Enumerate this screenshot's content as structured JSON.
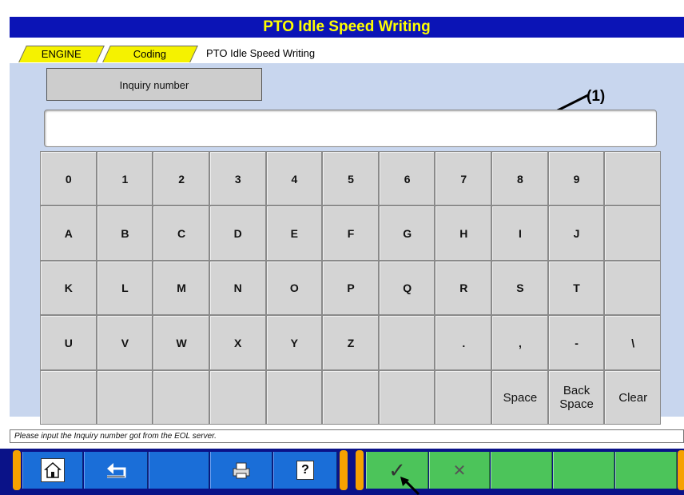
{
  "title": "PTO Idle Speed Writing",
  "breadcrumb": {
    "tab1": "ENGINE",
    "tab2": "Coding",
    "current": "PTO Idle Speed Writing"
  },
  "inquiry_label": "Inquiry number",
  "annotation": {
    "marker": "(1)"
  },
  "keypad": {
    "row1": [
      "0",
      "1",
      "2",
      "3",
      "4",
      "5",
      "6",
      "7",
      "8",
      "9",
      ""
    ],
    "row2": [
      "A",
      "B",
      "C",
      "D",
      "E",
      "F",
      "G",
      "H",
      "I",
      "J",
      ""
    ],
    "row3": [
      "K",
      "L",
      "M",
      "N",
      "O",
      "P",
      "Q",
      "R",
      "S",
      "T",
      ""
    ],
    "row4": [
      "U",
      "V",
      "W",
      "X",
      "Y",
      "Z",
      "",
      ".",
      ",",
      "-",
      "\\"
    ],
    "row5": [
      "",
      "",
      "",
      "",
      "",
      "",
      "",
      "",
      "Space",
      "Back\nSpace",
      "Clear"
    ]
  },
  "status_message": "Please input the Inquiry number got from the EOL server.",
  "toolbar": {
    "icons": [
      "home-icon",
      "back-arrow-icon",
      "",
      "printer-icon",
      "help-icon"
    ],
    "help_glyph": "?",
    "ok_glyph": "✓",
    "cancel_glyph": "✕"
  }
}
